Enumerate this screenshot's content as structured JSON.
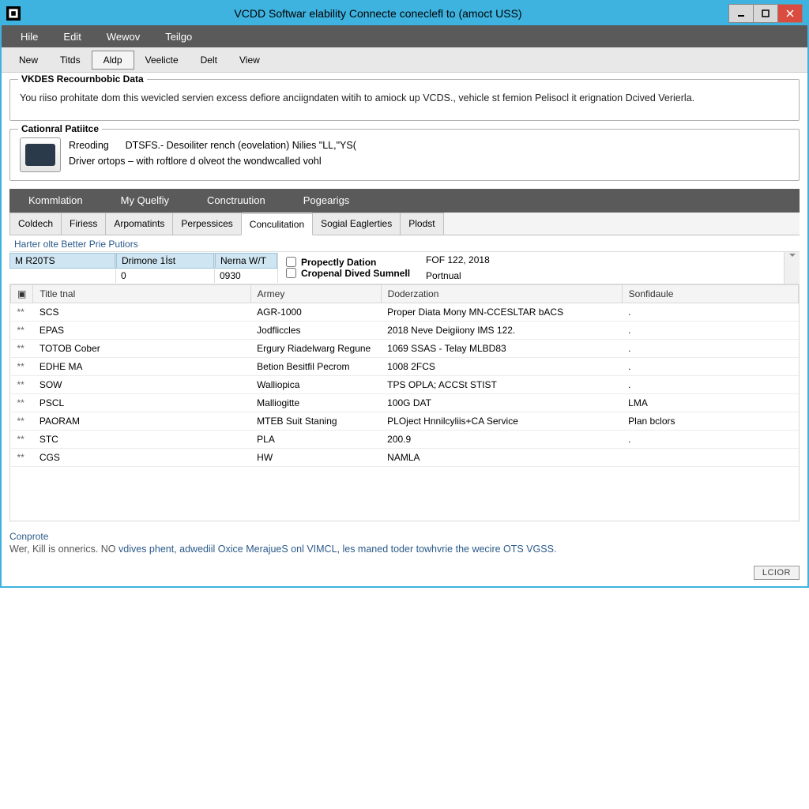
{
  "window_title": "VCDD Softwar elability Connecte coneclefl to (amoct USS)",
  "menubar": [
    "Hile",
    "Edit",
    "Wewov",
    "Teilgo"
  ],
  "toolbar": [
    "New",
    "Titds",
    "Aldp",
    "Veelicte",
    "Delt",
    "View"
  ],
  "toolbar_active_index": 2,
  "group1": {
    "title": "VKDES Recournbobic Data",
    "body": "You riiso prohitate dom this wevicled servien excess defiore anciigndaten witih to amiock up VCDS., vehicle st femion Pelisocl it erignation Dcived Verierla."
  },
  "group2": {
    "title": "Cationral Patiitce",
    "line1_a": "Rreoding",
    "line1_b": "DTSFS.- Desoiliter rench (eovelation) Nilies \"LL,\"YS(",
    "line2": "Driver ortops – with roftlore d olveot the wondwcalled vohl"
  },
  "darktabs": [
    "Kommlation",
    "My Quelfiy",
    "Conctruution",
    "Pogearigs"
  ],
  "subtabs": [
    "Coldech",
    "Firiess",
    "Arpomatints",
    "Perpessices",
    "Conculitation",
    "Sogial Eaglerties",
    "Plodst"
  ],
  "subtab_active_index": 4,
  "filter_header": "Harter olte Better Prie Putiors",
  "filters": {
    "col1_h": "M R20TS",
    "col1_v": "",
    "col2_h": "Drimone 1İst",
    "col2_v": "0",
    "col3_h": "Nerna W/T",
    "col3_v": "0930",
    "chk1": "Propectly Dation",
    "chk2": "Cropenal Dived Sumnell",
    "v1": "FOF 122, 2018",
    "v2": "Portnual"
  },
  "table": {
    "headers": [
      "",
      "Title tnal",
      "Armey",
      "Doderzation",
      "Sonfidaule"
    ],
    "rows": [
      [
        "**",
        "SCS",
        "AGR-1000",
        "Proper Diata Mony MN-CCESLTAR bACS",
        "."
      ],
      [
        "**",
        "EPAS",
        "Jodfliccles",
        "2018 Neve Deigiiony IMS 122.",
        "."
      ],
      [
        "**",
        "TOTOB Cober",
        "Ergury Riadelwarg Regune",
        "1069 SSAS - Telay MLBD83",
        "."
      ],
      [
        "**",
        "EDHE MA",
        "Betion Besitfil Pecrom",
        "1008 2FCS",
        "."
      ],
      [
        "**",
        "SOW",
        "Walliopica",
        "TPS OPLA; ACCSt STIST",
        "."
      ],
      [
        "**",
        "PSCL",
        "Malliogitte",
        "100G DAT",
        "LMA"
      ],
      [
        "**",
        "PAORAM",
        "MTEB Suit Staning",
        "PLOject Hnnilcyliis+CA Service",
        "Plan bclors"
      ],
      [
        "**",
        "STC",
        "PLA",
        "200.9",
        "."
      ],
      [
        "**",
        "CGS",
        "HW",
        "NAMLA",
        ""
      ]
    ]
  },
  "footer": {
    "label": "Conprote",
    "text_gray": "Wer, Kill is onnerics. NO ",
    "text_blue": "vdives phent, adwediil Oxice MerajueS onl VIMCL, les maned toder towhvrie the wecire OTS VGSS."
  },
  "close_button": "LCIOR"
}
